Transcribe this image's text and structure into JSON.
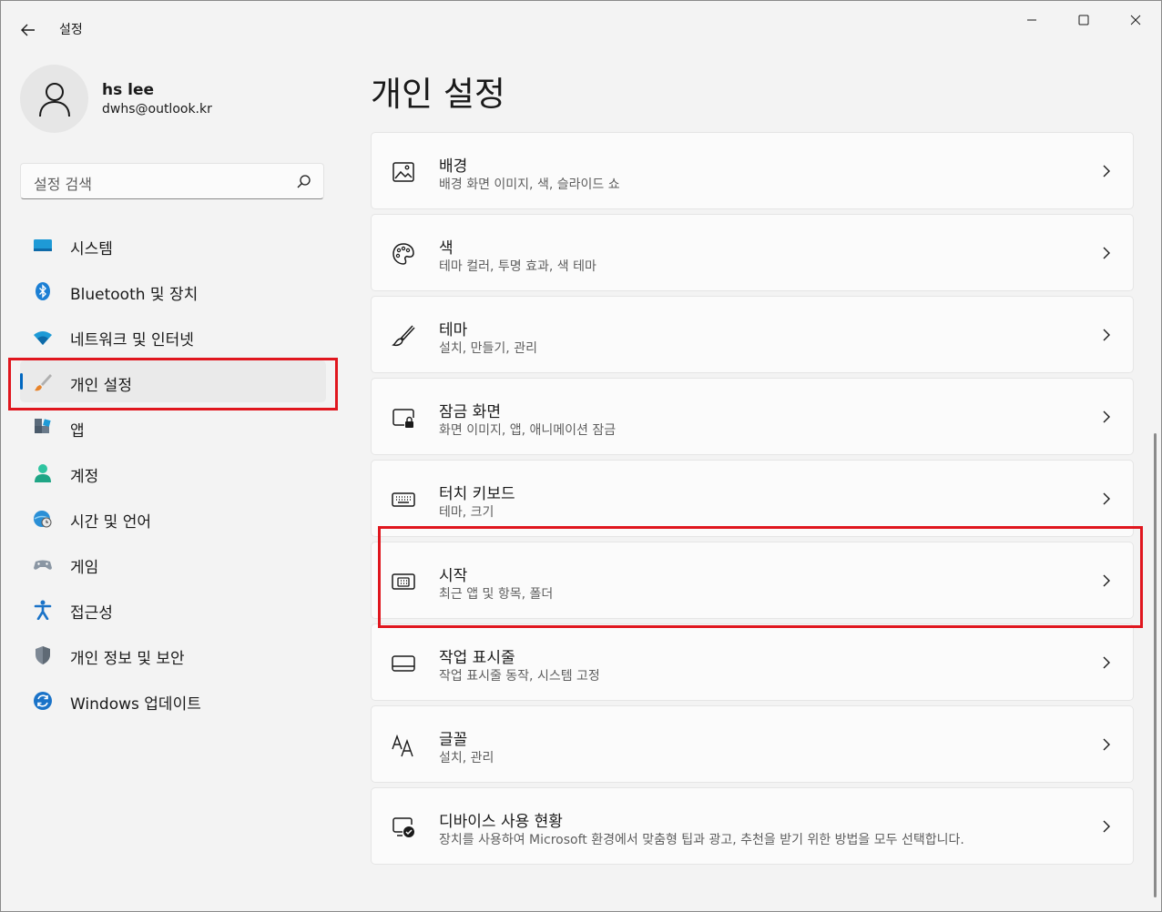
{
  "window": {
    "title": "설정",
    "controls": [
      "minimize-icon",
      "maximize-icon",
      "close-icon"
    ]
  },
  "profile": {
    "name": "hs lee",
    "email": "dwhs@outlook.kr"
  },
  "search": {
    "placeholder": "설정 검색"
  },
  "sidebar": {
    "items": [
      {
        "label": "시스템",
        "icon": "system-icon"
      },
      {
        "label": "Bluetooth 및 장치",
        "icon": "bluetooth-icon"
      },
      {
        "label": "네트워크 및 인터넷",
        "icon": "wifi-icon"
      },
      {
        "label": "개인 설정",
        "icon": "brush-icon",
        "active": true
      },
      {
        "label": "앱",
        "icon": "apps-icon"
      },
      {
        "label": "계정",
        "icon": "account-icon"
      },
      {
        "label": "시간 및 언어",
        "icon": "globe-clock-icon"
      },
      {
        "label": "게임",
        "icon": "gamepad-icon"
      },
      {
        "label": "접근성",
        "icon": "accessibility-icon"
      },
      {
        "label": "개인 정보 및 보안",
        "icon": "shield-icon"
      },
      {
        "label": "Windows 업데이트",
        "icon": "update-icon"
      }
    ]
  },
  "main": {
    "title": "개인 설정",
    "cards": [
      {
        "title": "배경",
        "subtitle": "배경 화면 이미지, 색, 슬라이드 쇼",
        "icon": "image-icon"
      },
      {
        "title": "색",
        "subtitle": "테마 컬러, 투명 효과, 색 테마",
        "icon": "palette-icon"
      },
      {
        "title": "테마",
        "subtitle": "설치, 만들기, 관리",
        "icon": "brush-icon"
      },
      {
        "title": "잠금 화면",
        "subtitle": "화면 이미지, 앱, 애니메이션 잠금",
        "icon": "lock-screen-icon"
      },
      {
        "title": "터치 키보드",
        "subtitle": "테마, 크기",
        "icon": "keyboard-icon"
      },
      {
        "title": "시작",
        "subtitle": "최근 앱 및 항목, 폴더",
        "icon": "start-menu-icon"
      },
      {
        "title": "작업 표시줄",
        "subtitle": "작업 표시줄 동작, 시스템 고정",
        "icon": "taskbar-icon"
      },
      {
        "title": "글꼴",
        "subtitle": "설치, 관리",
        "icon": "font-icon"
      },
      {
        "title": "디바이스 사용 현황",
        "subtitle": "장치를 사용하여 Microsoft 환경에서 맞춤형 팁과 광고, 추천을 받기 위한 방법을 모두 선택합니다.",
        "icon": "device-usage-icon"
      }
    ]
  },
  "colors": {
    "accent": "#0067c0",
    "highlight_box": "#e0161e",
    "background": "#f3f3f3",
    "card": "#fbfbfb"
  }
}
